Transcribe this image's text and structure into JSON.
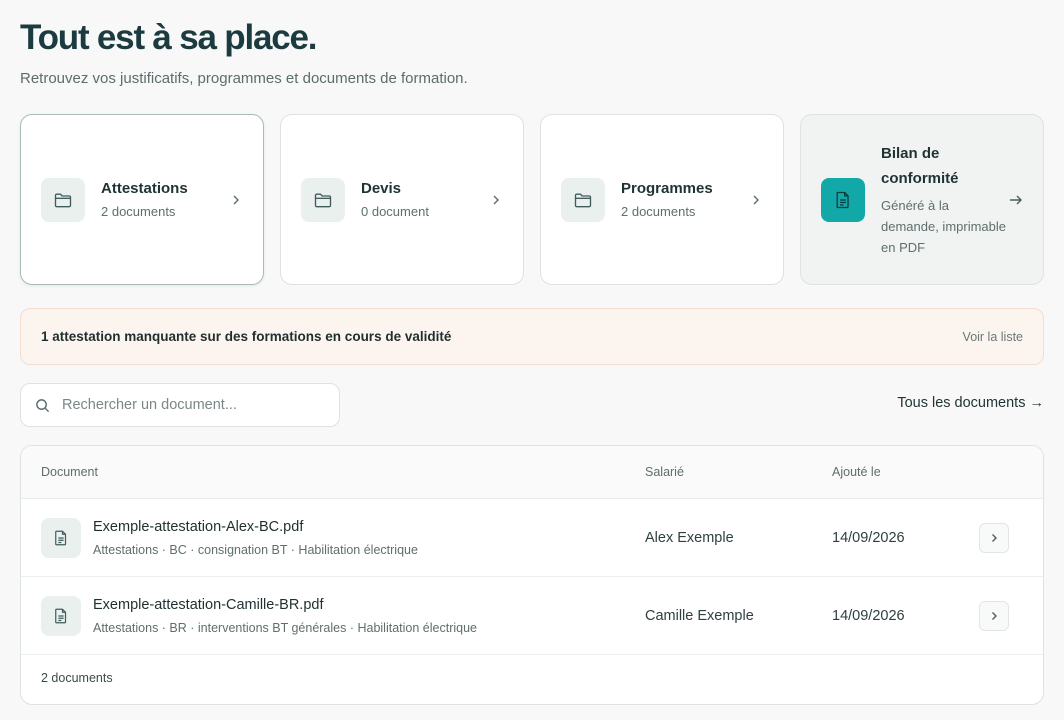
{
  "header": {
    "title": "Tout est à sa place.",
    "subtitle": "Retrouvez vos justificatifs, programmes et documents de formation."
  },
  "categories": [
    {
      "title": "Attestations",
      "count": "2 documents",
      "icon": "folder-icon"
    },
    {
      "title": "Devis",
      "count": "0 document",
      "icon": "folder-icon"
    },
    {
      "title": "Programmes",
      "count": "2 documents",
      "icon": "folder-icon"
    }
  ],
  "report_card": {
    "title": "Bilan de conformité",
    "description": "Généré à la demande, imprimable en PDF",
    "icon": "document-icon",
    "accent": "#13a8a8"
  },
  "alert": {
    "message": "1 attestation manquante sur des formations en cours de validité",
    "link": "Voir la liste"
  },
  "search": {
    "placeholder": "Rechercher un document...",
    "value": ""
  },
  "all_documents_link": "Tous les documents →",
  "table": {
    "columns": [
      "Document",
      "Salarié",
      "Ajouté le"
    ],
    "rows": [
      {
        "filename": "Exemple-attestation-Alex-BC.pdf",
        "meta": "Attestations · BC · consignation BT · Habilitation électrique",
        "employee": "Alex Exemple",
        "date": "14/09/2026"
      },
      {
        "filename": "Exemple-attestation-Camille-BR.pdf",
        "meta": "Attestations · BR · interventions BT générales · Habilitation électrique",
        "employee": "Camille Exemple",
        "date": "14/09/2026"
      }
    ],
    "footer": "2 documents"
  }
}
